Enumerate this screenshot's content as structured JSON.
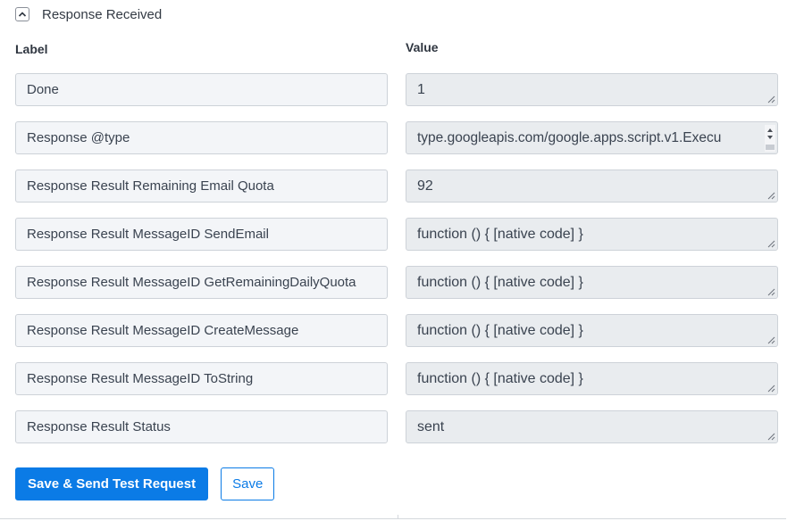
{
  "section": {
    "title": "Response Received",
    "toggle_icon": "chevron-up-icon"
  },
  "columns": {
    "label": "Label",
    "value": "Value"
  },
  "rows": [
    {
      "label": "Done",
      "value": "1"
    },
    {
      "label": "Response @type",
      "value": "type.googleapis.com/google.apps.script.v1.Execu"
    },
    {
      "label": "Response Result Remaining Email Quota",
      "value": "92"
    },
    {
      "label": "Response Result MessageID SendEmail",
      "value": "function () { [native code] }"
    },
    {
      "label": "Response Result MessageID GetRemainingDailyQuota",
      "value": "function () { [native code] }"
    },
    {
      "label": "Response Result MessageID CreateMessage",
      "value": "function () { [native code] }"
    },
    {
      "label": "Response Result MessageID ToString",
      "value": "function () { [native code] }"
    },
    {
      "label": "Response Result Status",
      "value": "sent"
    }
  ],
  "actions": {
    "save_send_label": "Save & Send Test Request",
    "save_label": "Save"
  },
  "colors": {
    "primary": "#0b7be6",
    "label_bg": "#f3f5f8",
    "value_bg": "#e9ecef",
    "border": "#cdd2d8"
  }
}
